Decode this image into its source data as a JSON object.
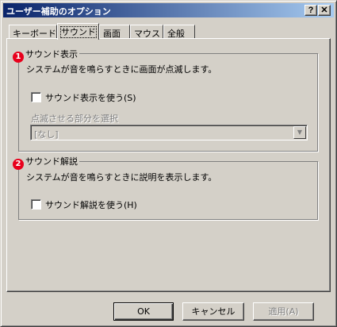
{
  "window": {
    "title": "ユーザー補助のオプション",
    "help_button": "?",
    "close_button": "✕"
  },
  "tabs": [
    {
      "label": "キーボード",
      "active": false
    },
    {
      "label": "サウンド",
      "active": true
    },
    {
      "label": "画面",
      "active": false
    },
    {
      "label": "マウス",
      "active": false
    },
    {
      "label": "全般",
      "active": false
    }
  ],
  "sound_display": {
    "badge": "1",
    "legend": "サウンド表示",
    "description": "システムが音を鳴らすときに画面が点滅します。",
    "checkbox_label": "サウンド表示を使う(S)",
    "checked": false,
    "select_label": "点滅させる部分を選択",
    "select_value": "[なし]"
  },
  "sound_caption": {
    "badge": "2",
    "legend": "サウンド解説",
    "description": "システムが音を鳴らすときに説明を表示します。",
    "checkbox_label": "サウンド解説を使う(H)",
    "checked": false
  },
  "buttons": {
    "ok": "OK",
    "cancel": "キャンセル",
    "apply": "適用(A)"
  }
}
